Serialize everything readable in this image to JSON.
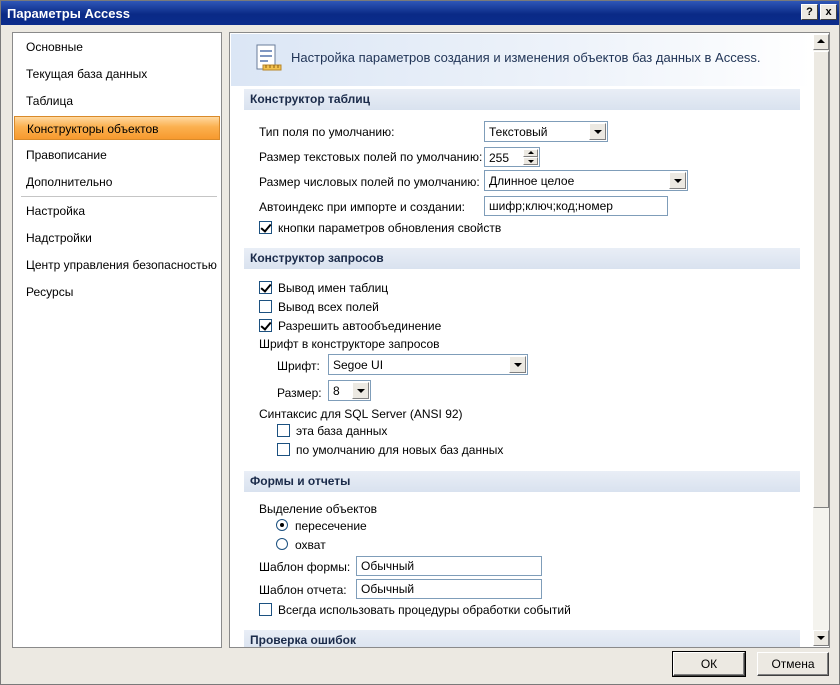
{
  "window": {
    "title": "Параметры Access",
    "help_glyph": "?",
    "close_glyph": "x"
  },
  "nav": {
    "items": [
      {
        "label": "Основные"
      },
      {
        "label": "Текущая база данных"
      },
      {
        "label": "Таблица"
      },
      {
        "label": "Конструкторы объектов",
        "selected": true
      },
      {
        "label": "Правописание"
      },
      {
        "label": "Дополнительно"
      },
      {
        "label": "Настройка"
      },
      {
        "label": "Надстройки"
      },
      {
        "label": "Центр управления безопасностью"
      },
      {
        "label": "Ресурсы"
      }
    ]
  },
  "banner": {
    "text": "Настройка параметров создания и изменения объектов баз данных в Access."
  },
  "tables": {
    "header": "Конструктор таблиц",
    "field_type_label": "Тип поля по умолчанию:",
    "field_type_value": "Текстовый",
    "text_size_label": "Размер текстовых полей по умолчанию:",
    "text_size_value": "255",
    "num_size_label": "Размер числовых полей по умолчанию:",
    "num_size_value": "Длинное целое",
    "autoindex_label": "Автоиндекс при импорте и создании:",
    "autoindex_value": "шифр;ключ;код;номер",
    "prop_update_label": "кнопки параметров обновления свойств",
    "prop_update_checked": true
  },
  "queries": {
    "header": "Конструктор запросов",
    "show_table_names_label": "Вывод имен таблиц",
    "show_table_names_checked": true,
    "output_all_fields_label": "Вывод всех полей",
    "output_all_fields_checked": false,
    "autojoin_label": "Разрешить автообъединение",
    "autojoin_checked": true,
    "font_group_label": "Шрифт в конструкторе запросов",
    "font_label": "Шрифт:",
    "font_value": "Segoe UI",
    "size_label": "Размер:",
    "size_value": "8",
    "sql_group_label": "Синтаксис для SQL Server (ANSI 92)",
    "this_db_label": "эта база данных",
    "this_db_checked": false,
    "default_new_label": "по умолчанию для новых баз данных",
    "default_new_checked": false
  },
  "forms": {
    "header": "Формы и отчеты",
    "selection_label": "Выделение объектов",
    "partial_label": "пересечение",
    "partial_checked": true,
    "full_label": "охват",
    "full_checked": false,
    "form_template_label": "Шаблон формы:",
    "form_template_value": "Обычный",
    "report_template_label": "Шаблон отчета:",
    "report_template_value": "Обычный",
    "always_events_label": "Всегда использовать процедуры обработки событий",
    "always_events_checked": false
  },
  "errors": {
    "header": "Проверка ошибок"
  },
  "buttons": {
    "ok": "ОК",
    "cancel": "Отмена"
  }
}
